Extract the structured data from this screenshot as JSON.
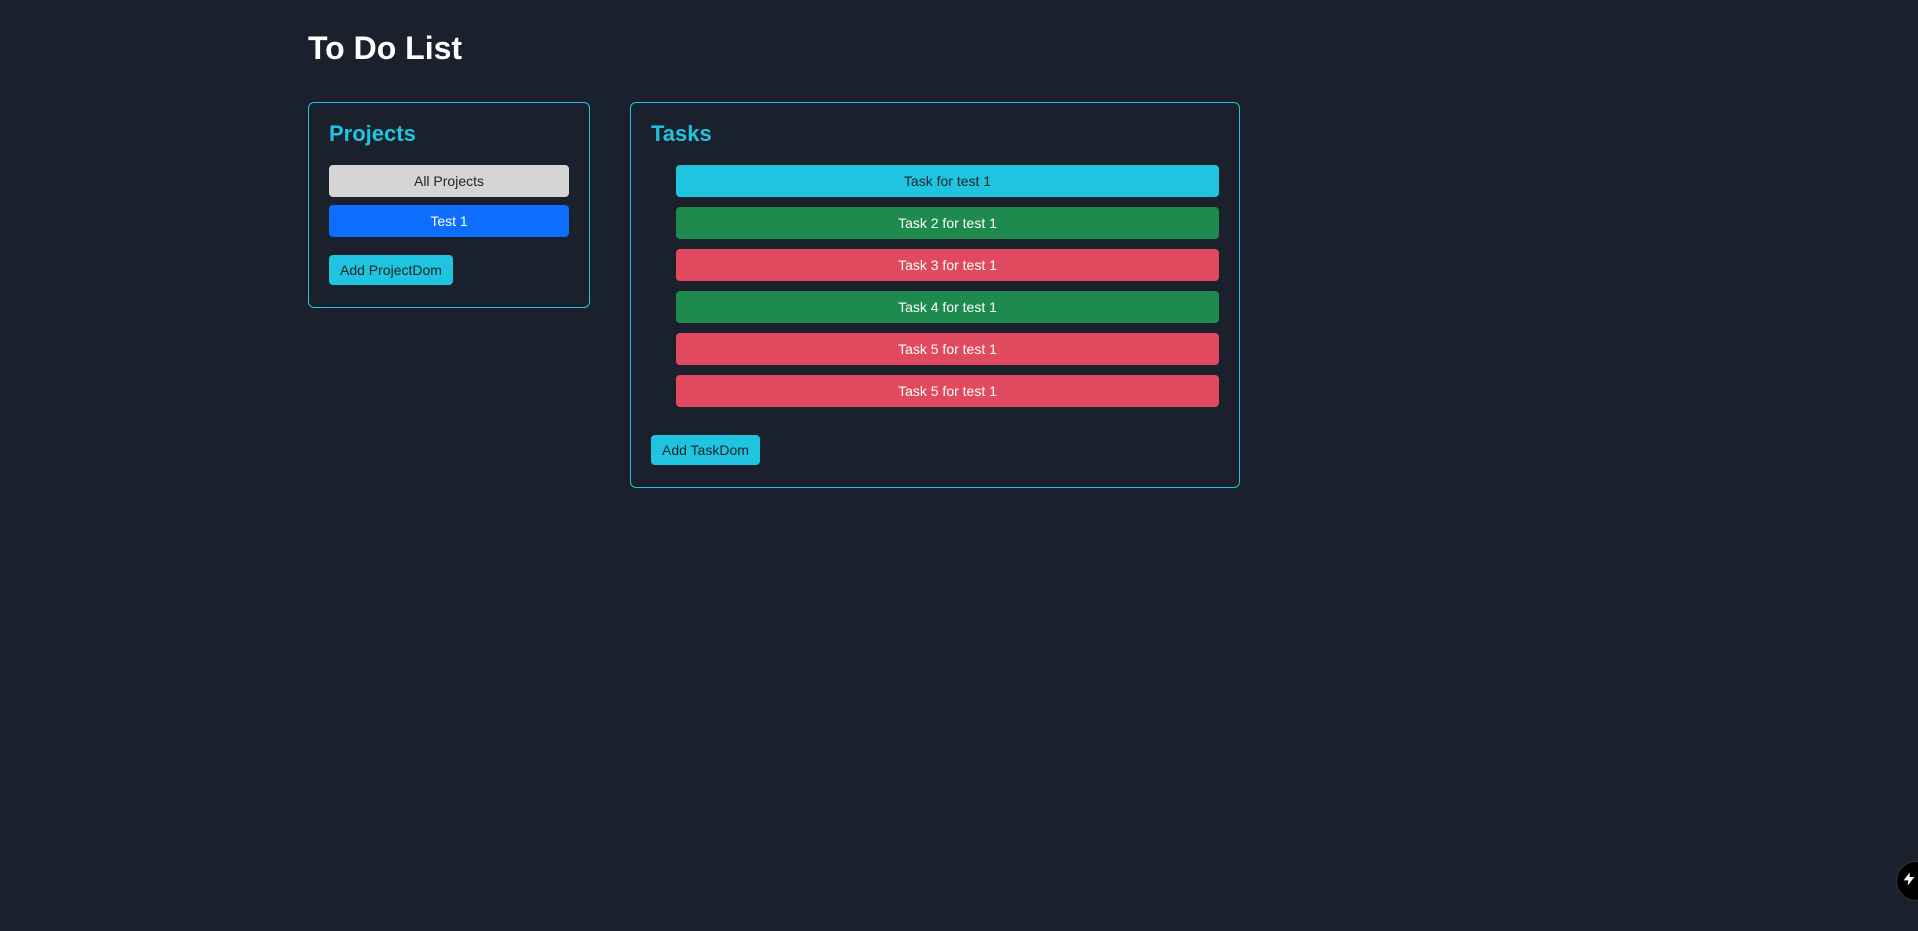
{
  "page": {
    "title": "To Do List"
  },
  "projects": {
    "heading": "Projects",
    "all_label": "All Projects",
    "items": [
      {
        "label": "Test 1"
      }
    ],
    "add_button": "Add ProjectDom"
  },
  "tasks": {
    "heading": "Tasks",
    "items": [
      {
        "label": "Task for test 1",
        "color": "cyan"
      },
      {
        "label": "Task 2 for test 1",
        "color": "green"
      },
      {
        "label": "Task 3 for test 1",
        "color": "red"
      },
      {
        "label": "Task 4 for test 1",
        "color": "green"
      },
      {
        "label": "Task 5 for test 1",
        "color": "red"
      },
      {
        "label": "Task 5 for test 1",
        "color": "red"
      }
    ],
    "add_button": "Add TaskDom"
  },
  "colors": {
    "cyan": "#1fc4e0",
    "green": "#1e8a4d",
    "red": "#e14a5e"
  }
}
